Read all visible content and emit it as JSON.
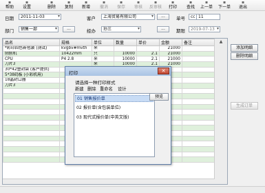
{
  "toolbar": {
    "buttons": [
      {
        "label": "帮助",
        "icon": "help-icon",
        "enabled": true
      },
      {
        "label": "设置",
        "icon": "gear-icon",
        "enabled": true
      },
      {
        "label": "删除",
        "icon": "delete-icon",
        "enabled": true
      },
      {
        "label": "复制",
        "icon": "copy-icon",
        "enabled": true
      },
      {
        "label": "新增",
        "icon": "new-icon",
        "enabled": true
      },
      {
        "label": "撤消",
        "icon": "undo-icon",
        "enabled": false
      },
      {
        "label": "保存",
        "icon": "save-icon",
        "enabled": false
      },
      {
        "label": "审核",
        "icon": "approve-icon",
        "enabled": false
      },
      {
        "label": "反审核",
        "icon": "unapprove-icon",
        "enabled": false
      },
      {
        "label": "打印",
        "icon": "print-icon",
        "enabled": true
      },
      {
        "label": "查找",
        "icon": "search-icon",
        "enabled": true
      },
      {
        "label": "上一单",
        "icon": "prev-icon",
        "enabled": true
      },
      {
        "label": "下一单",
        "icon": "next-icon",
        "enabled": true
      },
      {
        "label": "退出",
        "icon": "exit-icon",
        "enabled": true
      }
    ]
  },
  "form": {
    "date_label": "日期",
    "date_value": "2011-11-03",
    "customer_label": "客户",
    "customer_value": "上海贸易有限公司",
    "order_label": "单号",
    "order_prefix": "cc",
    "order_value": "11",
    "dept_label": "部门",
    "dept_value": "销售一部",
    "browse_button": "...",
    "manager_label": "经办",
    "manager_value": "孙三",
    "period_label": "期限",
    "period_value": "2019-07-13"
  },
  "grid": {
    "columns": [
      "品名",
      "规格",
      "单位",
      "数量",
      "单价",
      "金额",
      "备注"
    ],
    "rows": [
      [
        "*彩印四色新包装 (测试)",
        "kvgbv#mvth",
        "米",
        "",
        "",
        "21000",
        ""
      ],
      [
        "刨刨机",
        "10422mm",
        "只",
        "10000",
        "2.1",
        "21000",
        ""
      ],
      [
        "CPU",
        "P4 2.8",
        "米",
        "10000",
        "2.1",
        "21000",
        ""
      ],
      [
        "刀片3",
        "",
        "米",
        "10000",
        "2.1",
        "21000",
        ""
      ],
      [
        "30*42塑封袋 (客户提供)",
        "",
        "",
        "",
        "",
        "",
        ""
      ],
      [
        "5*38码板 (小彩机用)",
        "",
        "",
        "",
        "",
        "",
        ""
      ],
      [
        "18晶封口器",
        "",
        "",
        "",
        "",
        "",
        ""
      ],
      [
        "刀片3",
        "",
        "",
        "",
        "",
        "",
        ""
      ]
    ]
  },
  "side": {
    "add_row": "添加明细",
    "delete_row": "删除明细",
    "generate_order": "生成订单"
  },
  "dialog": {
    "title": "打印",
    "prompt": "请选择一种打印样式",
    "menu": [
      "新建",
      "删除",
      "重命名",
      "设计"
    ],
    "items": [
      "01 销售报价单",
      "02 报价单(含包装单位)",
      "03 现代式报价单(中英文版)"
    ],
    "selected_index": 0,
    "print_button": "预览",
    "close_glyph": "✕"
  }
}
